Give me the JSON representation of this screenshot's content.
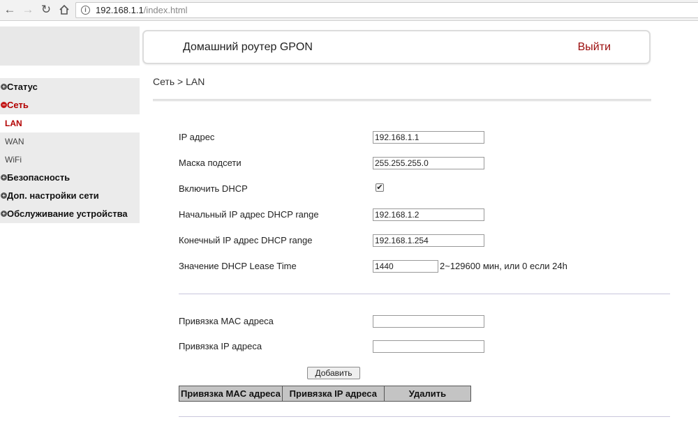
{
  "browser": {
    "url_host": "192.168.1.1",
    "url_path": "/index.html",
    "info_icon": "i"
  },
  "header": {
    "title": "Домашний роутер GPON",
    "logout": "Выйти"
  },
  "sidebar": {
    "items": [
      {
        "label": "Статус",
        "kind": "category",
        "icon": "+"
      },
      {
        "label": "Сеть",
        "kind": "category-active",
        "icon": "−"
      },
      {
        "label": "LAN",
        "kind": "sub-current"
      },
      {
        "label": "WAN",
        "kind": "sub"
      },
      {
        "label": "WiFi",
        "kind": "sub"
      },
      {
        "label": "Безопасность",
        "kind": "category",
        "icon": "+"
      },
      {
        "label": "Доп. настройки сети",
        "kind": "category",
        "icon": "+"
      },
      {
        "label": "Обслуживание устройства",
        "kind": "category",
        "icon": "+"
      }
    ]
  },
  "breadcrumb": "Сеть > LAN",
  "form": {
    "ip_label": "IP адрес",
    "ip_value": "192.168.1.1",
    "mask_label": "Маска подсети",
    "mask_value": "255.255.255.0",
    "dhcp_label": "Включить DHCP",
    "dhcp_checked": true,
    "dhcp_start_label": "Начальный IP адрес DHCP range",
    "dhcp_start_value": "192.168.1.2",
    "dhcp_end_label": "Конечный IP адрес DHCP range",
    "dhcp_end_value": "192.168.1.254",
    "lease_label": "Значение DHCP Lease Time",
    "lease_value": "1440",
    "lease_hint": "2~129600 мин, или 0 если 24h"
  },
  "binding": {
    "mac_label": "Привязка MAC адреса",
    "mac_value": "",
    "ip_label": "Привязка IP адреса",
    "ip_value": "",
    "add_button": "Добавить",
    "table_headers": [
      "Привязка MAC адреса",
      "Привязка IP адреса",
      "Удалить"
    ]
  },
  "colors": {
    "accent_red": "#b30000",
    "sidebar_bg": "#ebebeb",
    "table_header_bg": "#c4c4c4"
  }
}
